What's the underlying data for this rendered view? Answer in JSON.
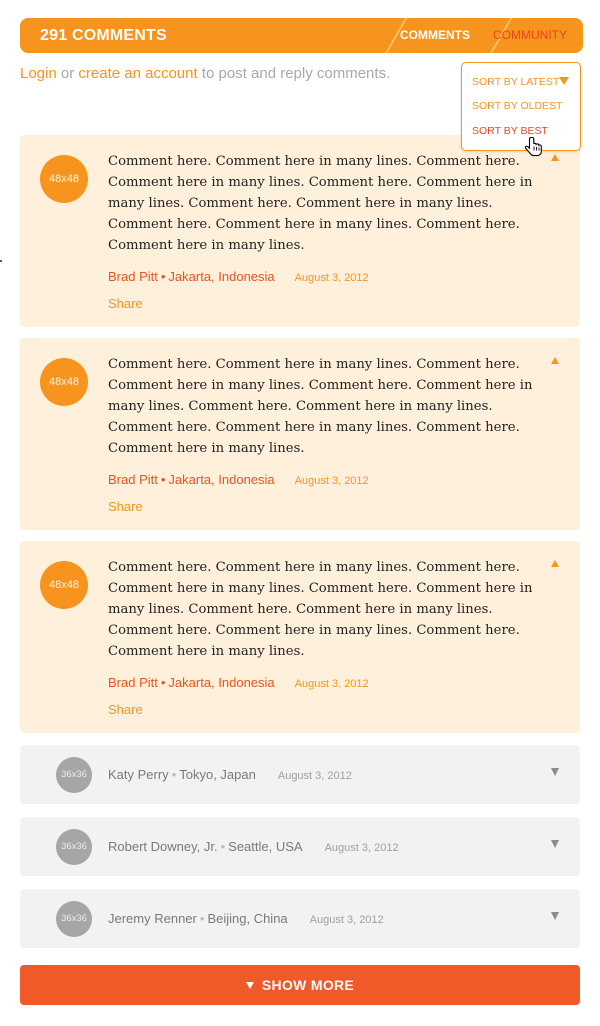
{
  "header": {
    "title": "291 COMMENTS",
    "tabs": [
      {
        "label": "COMMENTS"
      },
      {
        "label": "COMMUNITY"
      }
    ]
  },
  "login": {
    "login_link": "Login",
    "or_text": " or ",
    "create_link": "create an account",
    "suffix": " to post and reply comments."
  },
  "sort_menu": {
    "items": [
      "SORT BY LATEST",
      "SORT BY OLDEST",
      "SORT BY BEST"
    ]
  },
  "comments": [
    {
      "avatar": "48x48",
      "text": "Comment here. Comment here in many lines. Comment here. Comment here in many lines. Comment here. Comment here in many lines. Comment here. Comment here in many lines. Comment here. Comment here in many lines. Comment here. Comment here in many lines.",
      "author": "Brad Pitt",
      "separator": "•",
      "location": "Jakarta, Indonesia",
      "date": "August 3, 2012",
      "share": "Share"
    },
    {
      "avatar": "48x48",
      "text": "Comment here. Comment here in many lines. Comment here. Comment here in many lines. Comment here. Comment here in many lines. Comment here. Comment here in many lines. Comment here. Comment here in many lines. Comment here. Comment here in many lines.",
      "author": "Brad Pitt",
      "separator": "•",
      "location": "Jakarta, Indonesia",
      "date": "August 3, 2012",
      "share": "Share"
    },
    {
      "avatar": "48x48",
      "text": "Comment here. Comment here in many lines. Comment here. Comment here in many lines. Comment here. Comment here in many lines. Comment here. Comment here in many lines. Comment here. Comment here in many lines. Comment here. Comment here in many lines.",
      "author": "Brad Pitt",
      "separator": "•",
      "location": "Jakarta, Indonesia",
      "date": "August 3, 2012",
      "share": "Share"
    }
  ],
  "collapsed_comments": [
    {
      "avatar": "36x36",
      "author": "Katy Perry",
      "separator": "•",
      "location": "Tokyo, Japan",
      "date": "August 3, 2012"
    },
    {
      "avatar": "36x36",
      "author": "Robert Downey, Jr.",
      "separator": "•",
      "location": "Seattle, USA",
      "date": "August 3, 2012"
    },
    {
      "avatar": "36x36",
      "author": "Jeremy Renner",
      "separator": "•",
      "location": "Beijing, China",
      "date": "August 3, 2012"
    }
  ],
  "show_more": {
    "label": "SHOW MORE"
  },
  "colors": {
    "accent": "#f7941d",
    "accent_dark": "#e8451f",
    "show_more_bg": "#f05a28",
    "comment_bg": "#fff0dc",
    "collapsed_bg": "#f2f2f2"
  }
}
